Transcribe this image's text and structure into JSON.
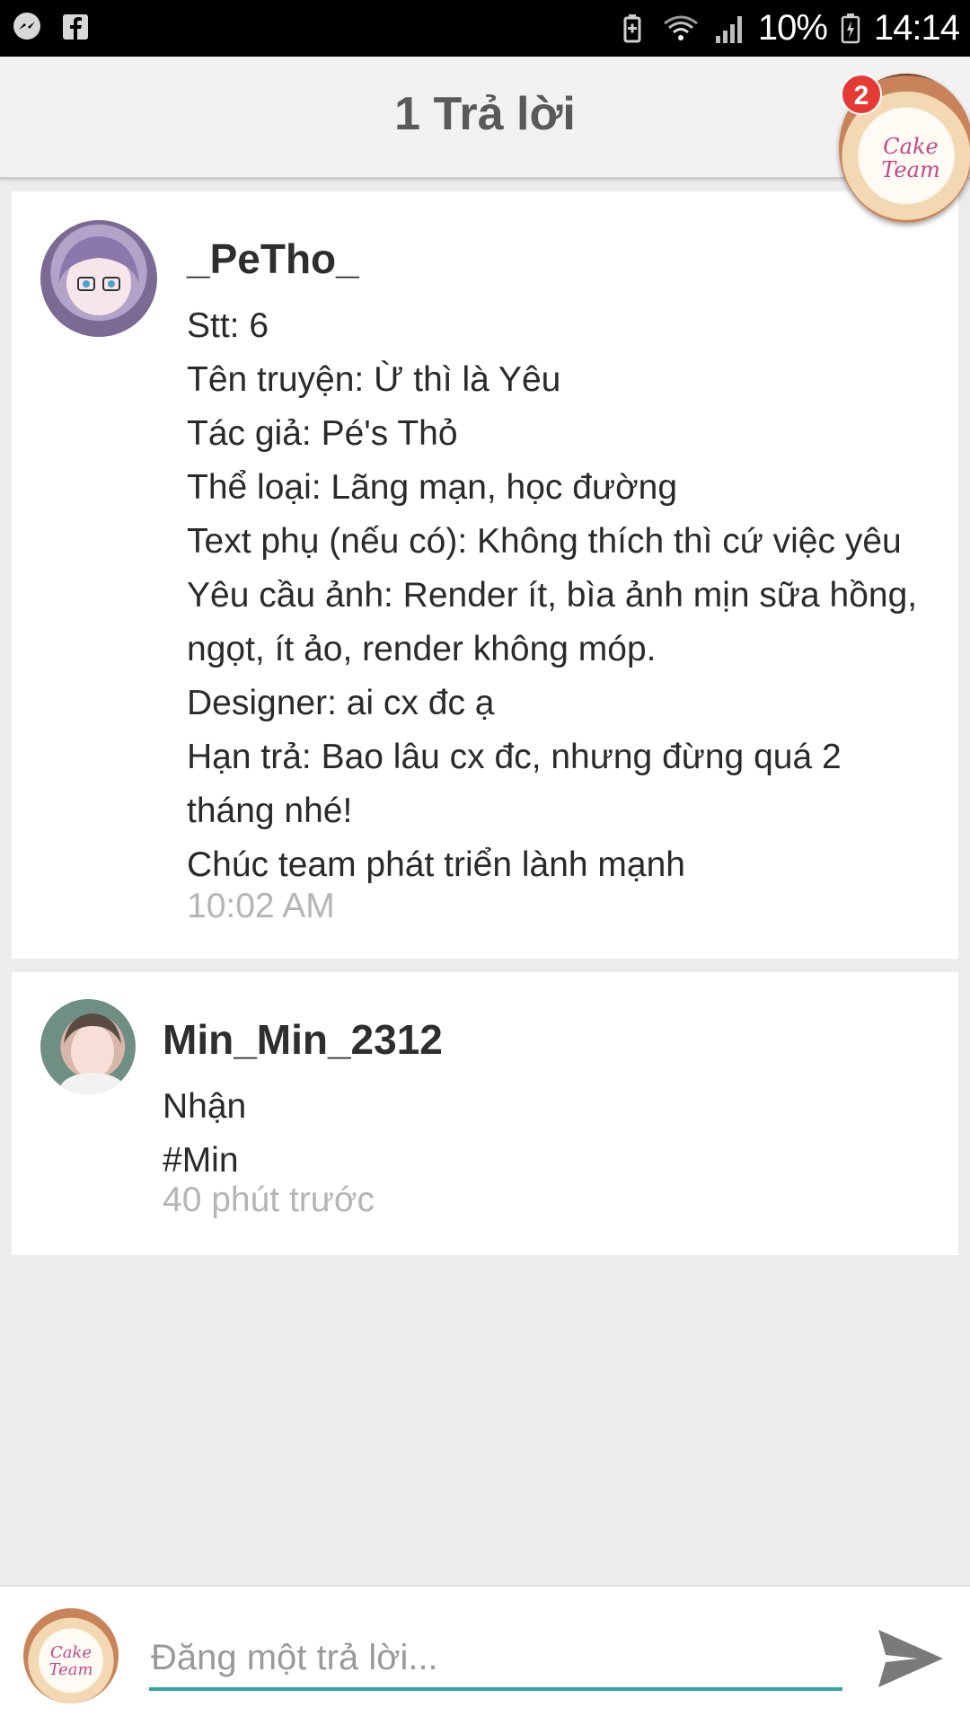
{
  "status_bar": {
    "battery": "10%",
    "time": "14:14",
    "left_icons": [
      "messenger-icon",
      "facebook-icon"
    ],
    "right_icons": [
      "battery-saver-icon",
      "wifi-icon",
      "signal-icon",
      "battery-icon"
    ]
  },
  "header": {
    "title": "1 Trả lời",
    "chathead": {
      "badge_count": "2",
      "avatar_text_line1": "Cake",
      "avatar_text_line2": "Team"
    }
  },
  "posts": [
    {
      "username": "_PeTho_",
      "lines": [
        "Stt: 6",
        "Tên truyện: Ừ thì là Yêu",
        "Tác giả: Pé's Thỏ",
        "Thể loại: Lãng mạn, học đường",
        "Text phụ (nếu có): Không thích thì cứ việc yêu",
        "Yêu cầu ảnh: Render ít, bìa ảnh mịn sữa hồng,",
        "ngọt, ít ảo, render không móp.",
        "Designer: ai cx đc ạ",
        "Hạn trả: Bao lâu cx đc, nhưng đừng quá 2",
        "tháng nhé!",
        "Chúc team phát triển lành mạnh"
      ],
      "timestamp": "10:02 AM"
    },
    {
      "username": "Min_Min_2312",
      "lines": [
        "Nhận",
        "#Min"
      ],
      "timestamp": "40 phút trước"
    }
  ],
  "reply_bar": {
    "placeholder": "Đăng một trả lời...",
    "avatar_text_line1": "Cake",
    "avatar_text_line2": "Team",
    "accent_color": "#2aa8a8"
  }
}
